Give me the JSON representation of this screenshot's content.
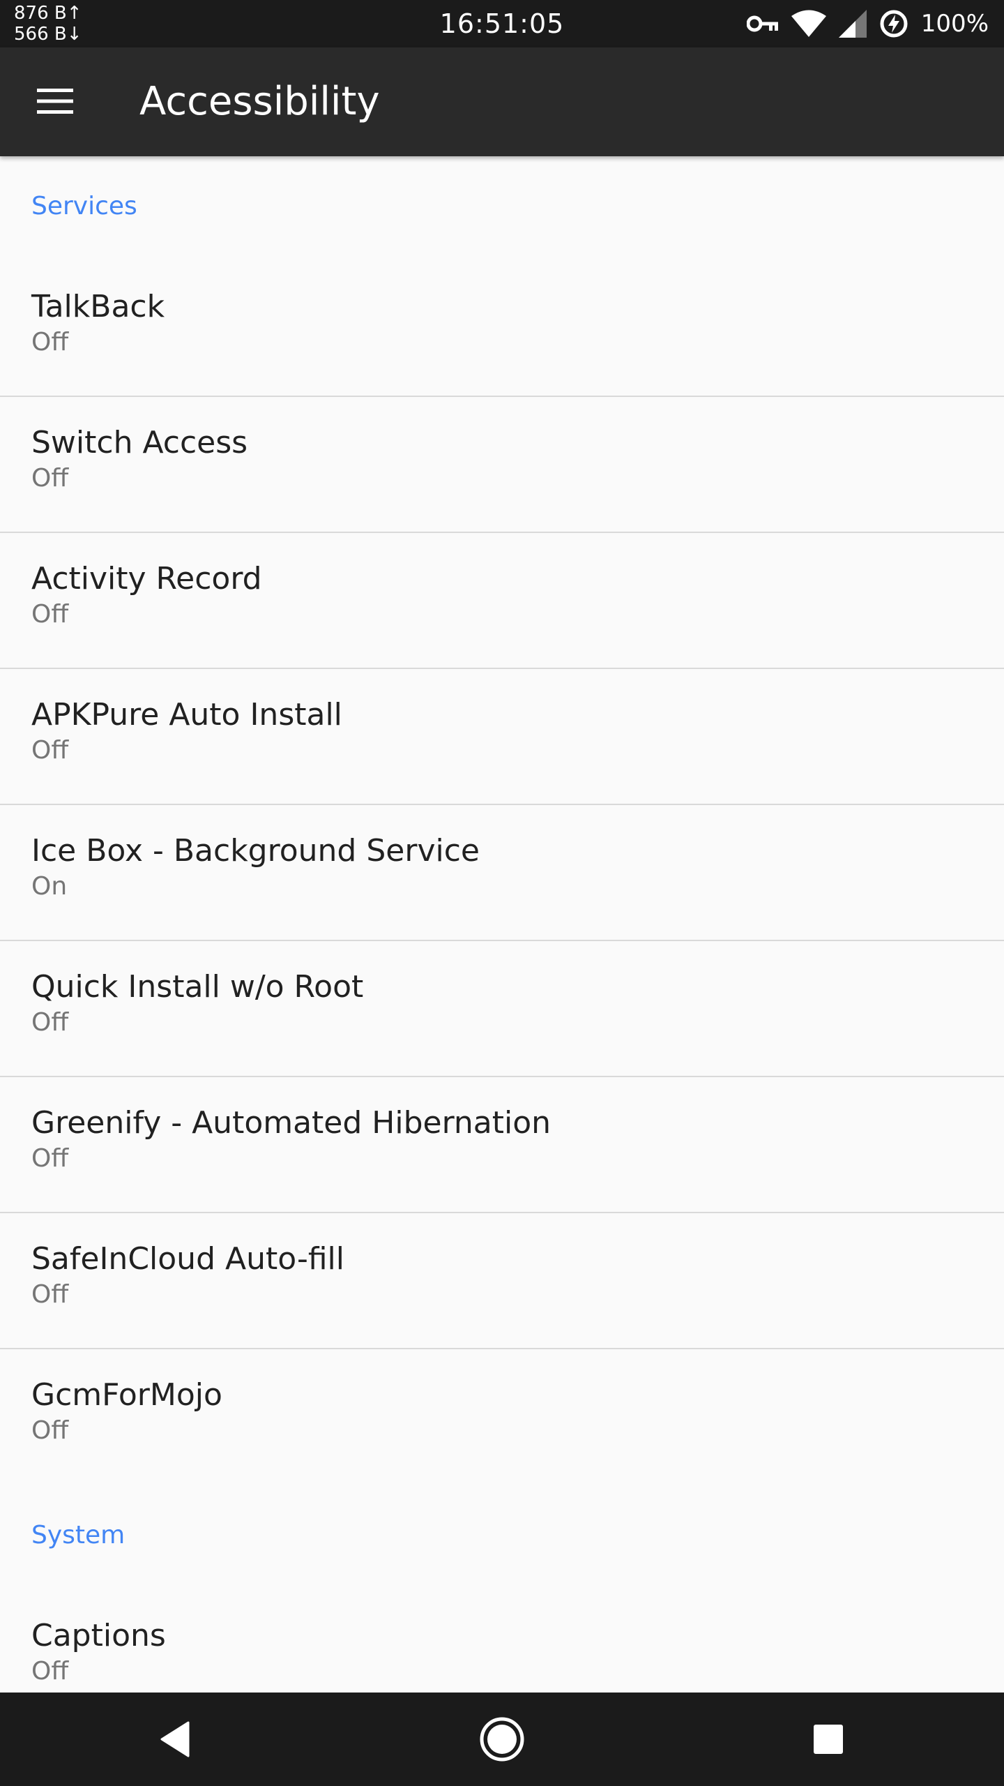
{
  "status_bar": {
    "net_up": "876 B↑",
    "net_down": "566 B↓",
    "time": "16:51:05",
    "battery": "100%",
    "icons": [
      "vpn-key-icon",
      "wifi-icon",
      "cell-signal-icon",
      "battery-charging-icon"
    ]
  },
  "app_bar": {
    "title": "Accessibility",
    "menu_icon": "hamburger-menu-icon"
  },
  "sections": {
    "services": {
      "header": "Services",
      "items": [
        {
          "title": "TalkBack",
          "summary": "Off"
        },
        {
          "title": "Switch Access",
          "summary": "Off"
        },
        {
          "title": "Activity Record",
          "summary": "Off"
        },
        {
          "title": "APKPure Auto Install",
          "summary": "Off"
        },
        {
          "title": "Ice Box - Background Service",
          "summary": "On"
        },
        {
          "title": "Quick Install w/o Root",
          "summary": "Off"
        },
        {
          "title": "Greenify - Automated Hibernation",
          "summary": "Off"
        },
        {
          "title": "SafeInCloud Auto-fill",
          "summary": "Off"
        },
        {
          "title": "GcmForMojo",
          "summary": "Off"
        }
      ]
    },
    "system": {
      "header": "System",
      "items": [
        {
          "title": "Captions",
          "summary": "Off"
        }
      ]
    }
  },
  "nav_bar": {
    "icons": [
      "back-icon",
      "home-icon",
      "recents-icon"
    ]
  },
  "colors": {
    "accent": "#4285f4",
    "app_bar": "#2a2a2a",
    "status_bar": "#1b1b1b",
    "background": "#fafafa"
  }
}
